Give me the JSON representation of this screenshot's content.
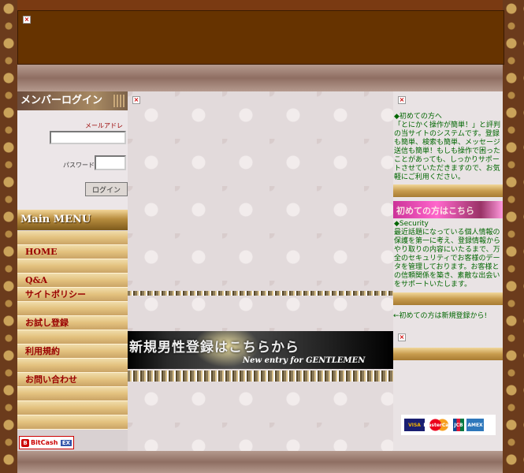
{
  "login": {
    "heading": "メンバーログイン",
    "email_label": "メールアドレス",
    "email_value": "",
    "password_label": "パスワード",
    "password_value": "",
    "submit_label": "ログイン"
  },
  "menu": {
    "heading": "Main MENU",
    "items": [
      {
        "label": ""
      },
      {
        "label": "HOME"
      },
      {
        "label": ""
      },
      {
        "label": "Q&A"
      },
      {
        "label": "サイトポリシー"
      },
      {
        "label": ""
      },
      {
        "label": "お試し登録"
      },
      {
        "label": ""
      },
      {
        "label": "利用規約"
      },
      {
        "label": ""
      },
      {
        "label": "お問い合わせ"
      },
      {
        "label": ""
      },
      {
        "label": ""
      },
      {
        "label": ""
      }
    ]
  },
  "badge": {
    "bitcash": "BitCash",
    "ex": "EX"
  },
  "center": {
    "entry_title": "新規男性登録はこちらから",
    "entry_sub": "New entry for GENTLEMEN"
  },
  "right": {
    "first_time_text": "◆初めての方へ\n「とにかく操作が簡単！」と評判の当サイトのシステムです。登録も簡単、検索も簡単、メッセージ送信も簡単！もしも操作で困ったことがあっても、しっかりサポートさせていただきますので、お気軽にご利用ください。",
    "pink_banner_text": "初めての方はこちら",
    "security_text": "◆Security\n最近話題になっている個人情報の保護を第一に考え、登録情報からやり取りの内容にいたるまで、万全のセキュリティでお客様のデータを管理しております。お客様との信頼関係を築き、素敵な出会いをサポートいたします。",
    "register_link": "←初めての方は新規登録から!"
  },
  "cards": {
    "visa": "VISA",
    "mastercard": "MasterCard",
    "jcb": "JCB",
    "amex": "AMEX"
  },
  "icons": {
    "broken": "broken-image-icon"
  },
  "colors": {
    "accent": "#663300",
    "link": "#006600",
    "menu_text": "#990000"
  }
}
